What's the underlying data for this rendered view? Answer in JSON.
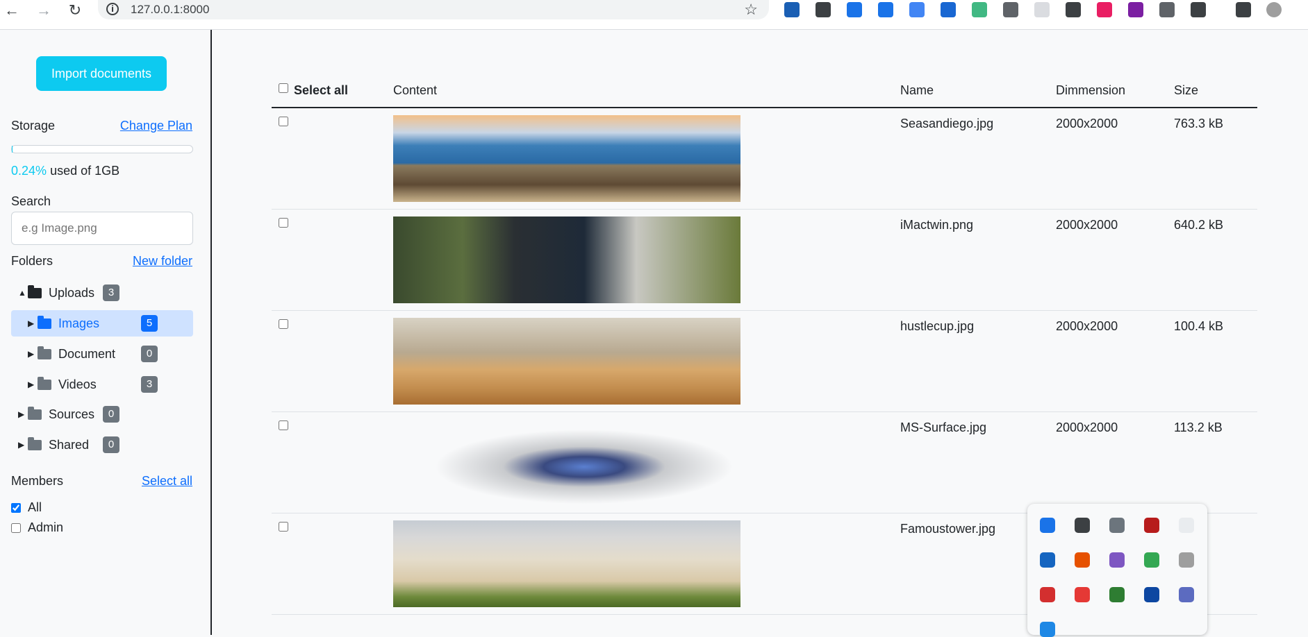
{
  "browser": {
    "url": "127.0.0.1:8000",
    "back_glyph": "←",
    "forward_glyph": "→",
    "reload_glyph": "↻",
    "info_glyph": "i",
    "star_glyph": "☆",
    "extension_colors": [
      "#1a5fb4",
      "#3c4043",
      "#1a73e8",
      "#1a73e8",
      "#4285f4",
      "#1967d2",
      "#41b883",
      "#5f6368",
      "#dadce0",
      "#3c4043",
      "#e91e63",
      "#7b1fa2",
      "#5f6368",
      "#3c4043",
      "#3c4043",
      "#9e9e9e"
    ]
  },
  "sidebar": {
    "import_button": "Import documents",
    "storage_label": "Storage",
    "change_plan": "Change Plan",
    "usage_fraction": 0.0024,
    "used_percent": "0.24%",
    "used_suffix": "used of 1GB",
    "search_label": "Search",
    "search_placeholder": "e.g Image.png",
    "folders_label": "Folders",
    "new_folder": "New folder",
    "tree": [
      {
        "label": "Uploads",
        "count": "3",
        "caret": "▲"
      },
      {
        "label": "Images",
        "count": "5",
        "caret": "▶"
      },
      {
        "label": "Document",
        "count": "0",
        "caret": "▶"
      },
      {
        "label": "Videos",
        "count": "3",
        "caret": "▶"
      },
      {
        "label": "Sources",
        "count": "0",
        "caret": "▶"
      },
      {
        "label": "Shared",
        "count": "0",
        "caret": "▶"
      }
    ],
    "members_label": "Members",
    "select_all": "Select all",
    "members": [
      {
        "label": "All",
        "checked": true
      },
      {
        "label": "Admin",
        "checked": false
      }
    ]
  },
  "table": {
    "headers": {
      "select_all": "Select all",
      "content": "Content",
      "name": "Name",
      "dimension": "Dimmension",
      "size": "Size"
    },
    "rows": [
      {
        "name": "Seasandiego.jpg",
        "dimension": "2000x2000",
        "size": "763.3 kB",
        "thumb": "coast"
      },
      {
        "name": "iMactwin.png",
        "dimension": "2000x2000",
        "size": "640.2 kB",
        "thumb": "office"
      },
      {
        "name": "hustlecup.jpg",
        "dimension": "2000x2000",
        "size": "100.4 kB",
        "thumb": "cups"
      },
      {
        "name": "MS-Surface.jpg",
        "dimension": "2000x2000",
        "size": "113.2 kB",
        "thumb": "laptop"
      },
      {
        "name": "Famoustower.jpg",
        "dimension": "2000x2000",
        "size": "kB",
        "thumb": "tower"
      }
    ]
  },
  "tray_popup": {
    "icons": [
      {
        "name": "zoho-icon",
        "color": "#1a73e8"
      },
      {
        "name": "vivaldi-icon",
        "color": "#3c4043"
      },
      {
        "name": "slack-icon",
        "color": "#6c757d"
      },
      {
        "name": "media-icon",
        "color": "#b71c1c"
      },
      {
        "name": "blank-icon",
        "color": "#e9ecef"
      },
      {
        "name": "shield-icon",
        "color": "#1565c0"
      },
      {
        "name": "xampp-icon",
        "color": "#e65100"
      },
      {
        "name": "feather-icon",
        "color": "#7e57c2"
      },
      {
        "name": "chrome-icon",
        "color": "#34a853"
      },
      {
        "name": "cloud-icon",
        "color": "#9e9e9e"
      },
      {
        "name": "stop-icon",
        "color": "#d32f2f"
      },
      {
        "name": "anydesk-icon",
        "color": "#e53935"
      },
      {
        "name": "signal-icon",
        "color": "#2e7d32"
      },
      {
        "name": "teamviewer-icon",
        "color": "#0d47a1"
      },
      {
        "name": "teams-icon",
        "color": "#5c6bc0"
      },
      {
        "name": "bluetooth-icon",
        "color": "#1e88e5"
      }
    ]
  }
}
